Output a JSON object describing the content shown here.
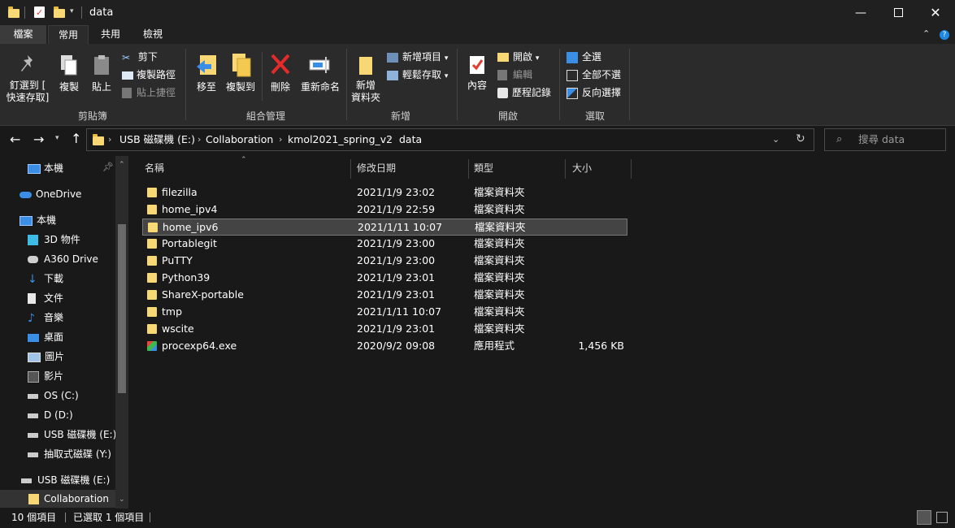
{
  "window": {
    "title": "data"
  },
  "ribbon_tabs": [
    "檔案",
    "常用",
    "共用",
    "檢視"
  ],
  "ribbon": {
    "clipboard": {
      "label": "剪貼簿",
      "pin": "釘選到 [\n快速存取]",
      "copy": "複製",
      "paste": "貼上",
      "cut": "剪下",
      "copy_path": "複製路徑",
      "paste_shortcut": "貼上捷徑"
    },
    "organize": {
      "label": "組合管理",
      "move_to": "移至",
      "copy_to": "複製到",
      "delete": "刪除",
      "rename": "重新命名"
    },
    "new": {
      "label": "新增",
      "new_folder": "新增\n資料夾",
      "new_item": "新增項目",
      "easy_access": "輕鬆存取"
    },
    "open": {
      "label": "開啟",
      "properties": "內容",
      "open": "開啟",
      "edit": "編輯",
      "history": "歷程記錄"
    },
    "select": {
      "label": "選取",
      "select_all": "全選",
      "select_none": "全部不選",
      "invert": "反向選擇"
    }
  },
  "address": {
    "crumbs": [
      "USB 磁碟機 (E:)",
      "Collaboration",
      "kmol2021_spring_v2",
      "data"
    ]
  },
  "search": {
    "placeholder": "搜尋 data"
  },
  "nav": {
    "quick_access": "本機",
    "onedrive": "OneDrive",
    "this_pc": "本機",
    "children": [
      "3D 物件",
      "A360 Drive",
      "下載",
      "文件",
      "音樂",
      "桌面",
      "圖片",
      "影片",
      "OS (C:)",
      "D (D:)",
      "USB 磁碟機 (E:)",
      "抽取式磁碟 (Y:)"
    ],
    "usb": "USB 磁碟機 (E:)",
    "collab": "Collaboration"
  },
  "columns": {
    "name": "名稱",
    "modified": "修改日期",
    "type": "類型",
    "size": "大小"
  },
  "files": [
    {
      "name": "filezilla",
      "date": "2021/1/9 23:02",
      "type": "檔案資料夾",
      "size": ""
    },
    {
      "name": "home_ipv4",
      "date": "2021/1/9 22:59",
      "type": "檔案資料夾",
      "size": ""
    },
    {
      "name": "home_ipv6",
      "date": "2021/1/11 10:07",
      "type": "檔案資料夾",
      "size": ""
    },
    {
      "name": "Portablegit",
      "date": "2021/1/9 23:00",
      "type": "檔案資料夾",
      "size": ""
    },
    {
      "name": "PuTTY",
      "date": "2021/1/9 23:00",
      "type": "檔案資料夾",
      "size": ""
    },
    {
      "name": "Python39",
      "date": "2021/1/9 23:01",
      "type": "檔案資料夾",
      "size": ""
    },
    {
      "name": "ShareX-portable",
      "date": "2021/1/9 23:01",
      "type": "檔案資料夾",
      "size": ""
    },
    {
      "name": "tmp",
      "date": "2021/1/11 10:07",
      "type": "檔案資料夾",
      "size": ""
    },
    {
      "name": "wscite",
      "date": "2021/1/9 23:01",
      "type": "檔案資料夾",
      "size": ""
    },
    {
      "name": "procexp64.exe",
      "date": "2020/9/2 09:08",
      "type": "應用程式",
      "size": "1,456 KB"
    }
  ],
  "status": {
    "count": "10 個項目",
    "selected": "已選取 1 個項目"
  }
}
